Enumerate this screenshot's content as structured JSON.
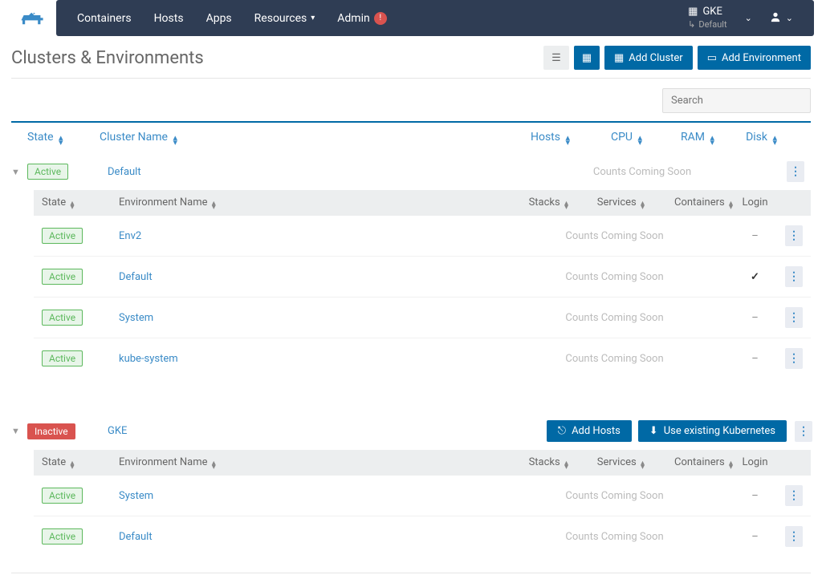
{
  "nav": {
    "items": [
      "Containers",
      "Hosts",
      "Apps",
      "Resources",
      "Admin"
    ],
    "admin_badge": "!",
    "env_main": "GKE",
    "env_sub": "Default"
  },
  "page": {
    "title": "Clusters & Environments",
    "add_cluster": "Add Cluster",
    "add_env": "Add Environment",
    "search_ph": "Search"
  },
  "cols": {
    "state": "State",
    "cname": "Cluster Name",
    "hosts": "Hosts",
    "cpu": "CPU",
    "ram": "RAM",
    "disk": "Disk"
  },
  "ecols": {
    "state": "State",
    "name": "Environment Name",
    "stacks": "Stacks",
    "services": "Services",
    "containers": "Containers",
    "login": "Login"
  },
  "coming": "Counts Coming Soon",
  "btn": {
    "add_hosts": "Add Hosts",
    "use_k8s": "Use existing Kubernetes"
  },
  "clusters": [
    {
      "state": "Active",
      "name": "Default",
      "envs": [
        {
          "state": "Active",
          "name": "Env2",
          "login": "-"
        },
        {
          "state": "Active",
          "name": "Default",
          "login": "✓"
        },
        {
          "state": "Active",
          "name": "System",
          "login": "-"
        },
        {
          "state": "Active",
          "name": "kube-system",
          "login": "-"
        }
      ]
    },
    {
      "state": "Inactive",
      "name": "GKE",
      "actions": true,
      "envs": [
        {
          "state": "Active",
          "name": "System",
          "login": "-"
        },
        {
          "state": "Active",
          "name": "Default",
          "login": "-"
        }
      ]
    }
  ]
}
